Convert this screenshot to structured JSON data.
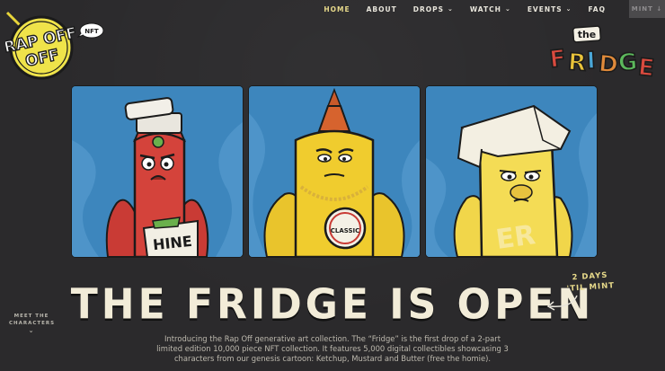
{
  "nav": {
    "items": [
      {
        "label": "HOME",
        "active": true,
        "dropdown": false
      },
      {
        "label": "ABOUT",
        "active": false,
        "dropdown": false
      },
      {
        "label": "DROPS",
        "active": false,
        "dropdown": true
      },
      {
        "label": "WATCH",
        "active": false,
        "dropdown": true
      },
      {
        "label": "EVENTS",
        "active": false,
        "dropdown": true
      },
      {
        "label": "FAQ",
        "active": false,
        "dropdown": false
      }
    ],
    "mint_label": "MINT"
  },
  "logo": {
    "text": "RAP OFF",
    "badge": "NFT"
  },
  "fridge_logo": {
    "the": "the",
    "title": "FRIDGE"
  },
  "cards": [
    {
      "name": "ketchup",
      "label": "HINE"
    },
    {
      "name": "mustard",
      "label": "CLASSIC"
    },
    {
      "name": "butter",
      "label": "ER"
    }
  ],
  "headline": "THE FRIDGE IS OPEN",
  "countdown": {
    "line1": "2 DAYS",
    "line2": "'TIL MINT"
  },
  "meet": {
    "line1": "MEET THE",
    "line2": "CHARACTERS"
  },
  "intro": "Introducing the Rap Off generative art collection. The “Fridge” is the first drop of a 2-part limited edition 10,000 piece NFT collection. It features 5,000 digital collectibles showcasing 3 characters from our genesis cartoon: Ketchup, Mustard and Butter (free the homie).",
  "colors": {
    "accent": "#e7d98a",
    "background": "#2b2a2c",
    "card_bg": "#3e82b6"
  }
}
